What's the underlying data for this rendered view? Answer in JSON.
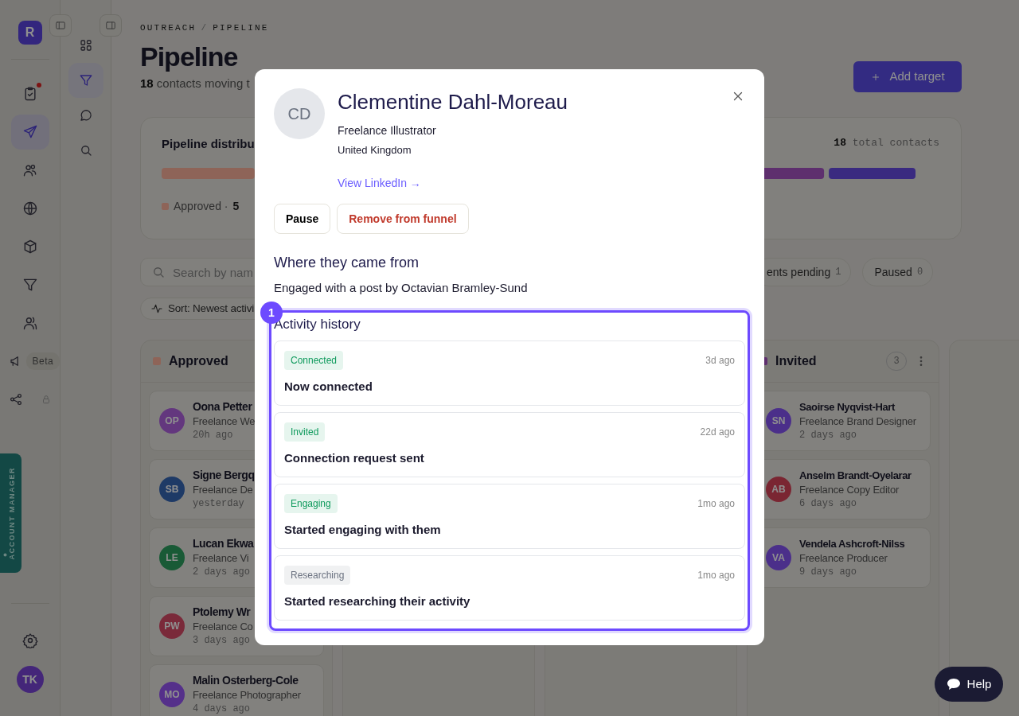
{
  "rail": {
    "logo": "R",
    "items": [
      {
        "kind": "clipboard",
        "selected": false,
        "notification": true
      },
      {
        "kind": "send",
        "selected": true,
        "notification": false
      },
      {
        "kind": "users",
        "selected": false,
        "notification": false
      },
      {
        "kind": "globe",
        "selected": false,
        "notification": false
      },
      {
        "kind": "box",
        "selected": false,
        "notification": false
      },
      {
        "kind": "funnel",
        "selected": false,
        "notification": false
      },
      {
        "kind": "team",
        "selected": false,
        "notification": false
      }
    ],
    "extras": [
      {
        "kind": "megaphone",
        "badge": "Beta",
        "locked": false
      },
      {
        "kind": "share",
        "locked": true
      }
    ],
    "account_tab": "ACCOUNT MANAGER",
    "avatar": "TK"
  },
  "subnav": {
    "items": [
      {
        "kind": "grid",
        "selected": false
      },
      {
        "kind": "funnel",
        "selected": true
      },
      {
        "kind": "chat",
        "selected": false
      },
      {
        "kind": "search",
        "selected": false
      }
    ]
  },
  "breadcrumb": [
    "OUTREACH",
    "PIPELINE"
  ],
  "breadcrumb_separator": "/",
  "title": "Pipeline",
  "subtitle": "**18** contacts moving t",
  "add_button": "Add target",
  "distribution": {
    "title": "Pipeline distribu",
    "total": "18",
    "total_label": "total contacts",
    "legend": [
      {
        "label": "Approved ·",
        "count": "5",
        "color": "#8e6458"
      }
    ]
  },
  "search": {
    "placeholder": "Search by nam"
  },
  "filters": [
    {
      "label": "ents pending",
      "count": "1"
    },
    {
      "label": "Paused",
      "count": "0"
    }
  ],
  "sort": "Sort: Newest activi",
  "columns": [
    {
      "kind": "stage",
      "title": "Approved",
      "color": "#8e6458",
      "cards": [
        {
          "initials": "OP",
          "color": "#63377e",
          "name": "Oona Petter",
          "role": "Freelance We",
          "time": "20h ago"
        },
        {
          "initials": "SB",
          "color": "#1f3a66",
          "name": "Signe Bergq",
          "role": "Freelance De",
          "time": "yesterday"
        },
        {
          "initials": "LE",
          "color": "#1a5a36",
          "name": "Lucan Ekwa",
          "role": "Freelance Vi",
          "time": "2 days ago"
        },
        {
          "initials": "PW",
          "color": "#7a2a3a",
          "name": "Ptolemy Wr",
          "role": "Freelance Co",
          "time": "3 days ago"
        },
        {
          "initials": "MO",
          "color": "#55308a",
          "name": "Malin Osterberg-Cole",
          "role": "Freelance Photographer",
          "time": "4 days ago"
        }
      ]
    },
    {
      "kind": "covered"
    },
    {
      "kind": "covered"
    },
    {
      "kind": "stage",
      "title": "Invited",
      "color": "#5e2f6e",
      "count": "3",
      "cards": [
        {
          "initials": "SN",
          "color": "#4b2f8a",
          "name": "Saoirse Nyqvist-Hart",
          "role": "Freelance Brand Designer",
          "time": "2 days ago"
        },
        {
          "initials": "AB",
          "color": "#7a2632",
          "name": "Anselm Brandt-Oyelarar",
          "role": "Freelance Copy Editor",
          "time": "6 days ago"
        },
        {
          "initials": "VA",
          "color": "#4b2f8a",
          "name": "Vendela Ashcroft-Nilss",
          "role": "Freelance Producer",
          "time": "9 days ago"
        }
      ]
    },
    {
      "kind": "covered"
    }
  ],
  "help_button": "Help",
  "modal": {
    "initials": "CD",
    "name": "Clementine Dahl-Moreau",
    "role": "Freelance Illustrator",
    "country": "United Kingdom",
    "link": "View LinkedIn →",
    "actions": [
      {
        "label": "Pause",
        "kind": "neutral"
      },
      {
        "label": "Remove from funnel",
        "kind": "danger"
      }
    ],
    "source_title": "Where they came from",
    "source_text": "Engaged with a post by Octavian Bramley-Sund",
    "activity": {
      "step": "1",
      "title": "Activity history",
      "items": [
        {
          "status": "Connected",
          "color": "#0e9a5c",
          "time": "3d ago",
          "text": "Now connected"
        },
        {
          "status": "Invited",
          "color": "#0e9a5c",
          "time": "22d ago",
          "text": "Connection request sent"
        },
        {
          "status": "Engaging",
          "color": "#0e9a5c",
          "time": "1mo ago",
          "text": "Started engaging with them"
        },
        {
          "status": "Researching",
          "color": "#6b7280",
          "time": "1mo ago",
          "text": "Started researching their activity"
        }
      ]
    }
  }
}
